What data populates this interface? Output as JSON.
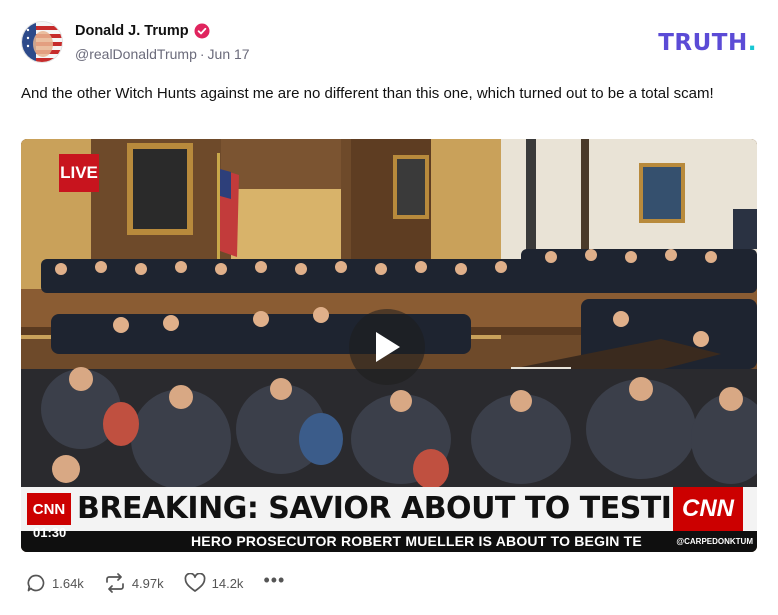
{
  "author": {
    "name": "Donald J. Trump",
    "handle": "@realDonaldTrump",
    "date": "Jun 17",
    "separator": "·"
  },
  "brand": {
    "main": "TRUTH",
    "accent": "."
  },
  "post": {
    "text": "And the other Witch Hunts against me are no different than this one, which turned out to be a total scam!"
  },
  "video": {
    "live_label": "LIVE",
    "chyron_logo_left": "CNN",
    "headline": "BREAKING: SAVIOR ABOUT TO TESTIFY",
    "chyron_logo_right": "CNN",
    "ticker": "HERO PROSECUTOR ROBERT MUELLER IS ABOUT TO BEGIN TE",
    "watermark": "@CARPEDONKTUM",
    "timestamp": "01:30"
  },
  "actions": {
    "replies": "1.64k",
    "retruths": "4.97k",
    "likes": "14.2k",
    "more": "•••"
  },
  "colors": {
    "brand_purple": "#5b4bd6",
    "brand_teal": "#18c7d3",
    "verified": "#e0245e",
    "cnn_red": "#cc0000",
    "live_red": "#c8141e"
  },
  "icons": [
    "verified-badge-icon",
    "play-icon",
    "reply-icon",
    "retruth-icon",
    "like-icon",
    "more-icon"
  ]
}
